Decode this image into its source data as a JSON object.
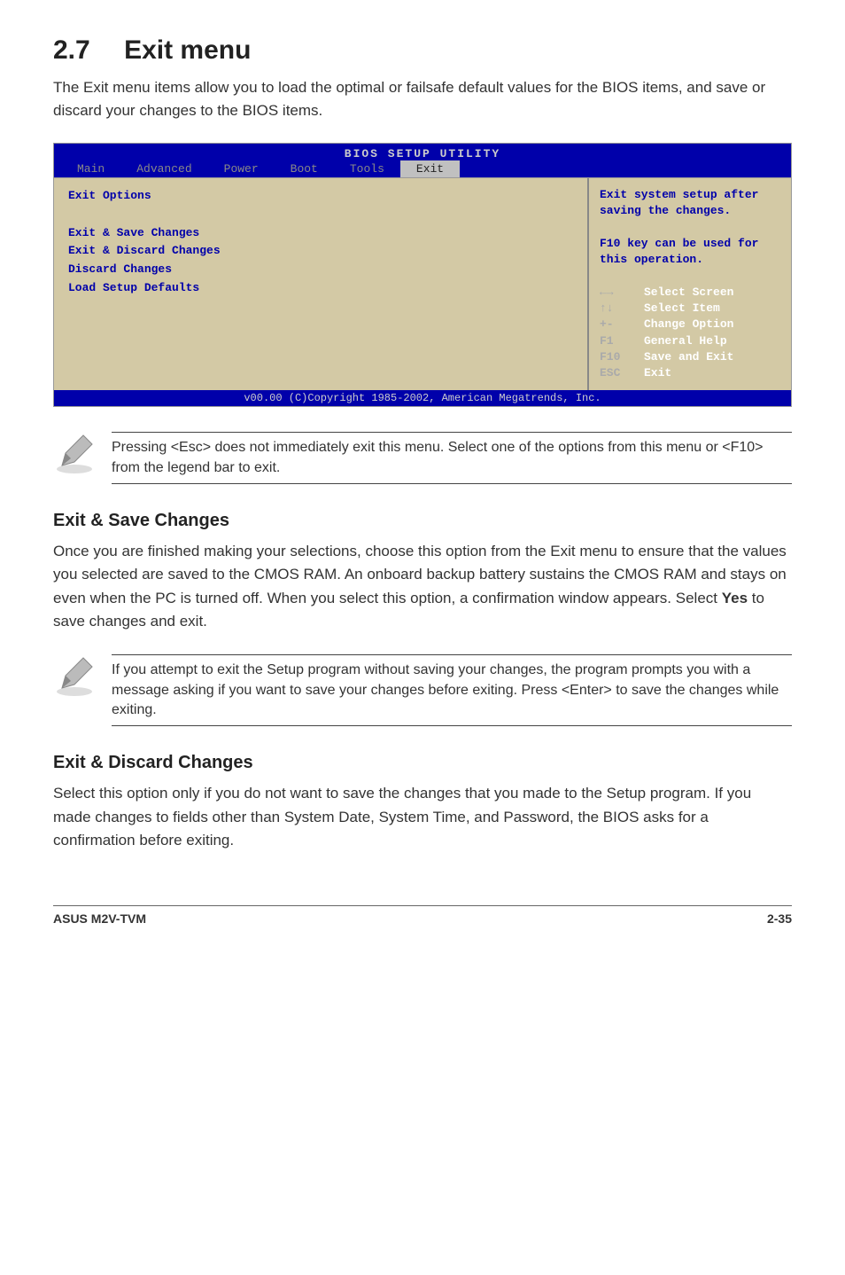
{
  "heading_number": "2.7",
  "heading_title": "Exit menu",
  "intro": "The Exit menu items allow you to load the optimal or failsafe default values for the BIOS items, and save or discard your changes to the BIOS items.",
  "bios": {
    "title": "BIOS SETUP UTILITY",
    "tabs": [
      "Main",
      "Advanced",
      "Power",
      "Boot",
      "Tools",
      "Exit"
    ],
    "left_header": "Exit Options",
    "left_items": [
      "Exit & Save Changes",
      "Exit & Discard Changes",
      "Discard Changes",
      "",
      "Load Setup Defaults"
    ],
    "right_help_1": "Exit system setup after saving the changes.",
    "right_help_2": "F10 key can be used for this operation.",
    "legend": [
      {
        "key": "←→",
        "desc": "Select Screen"
      },
      {
        "key": "↑↓",
        "desc": "Select Item"
      },
      {
        "key": "+-",
        "desc": "Change Option"
      },
      {
        "key": "F1",
        "desc": "General Help"
      },
      {
        "key": "F10",
        "desc": "Save and Exit"
      },
      {
        "key": "ESC",
        "desc": "Exit"
      }
    ],
    "footer": "v00.00 (C)Copyright 1985-2002, American Megatrends, Inc."
  },
  "note1": "Pressing <Esc> does not immediately exit this menu. Select one of the options from this menu or <F10> from the legend bar to exit.",
  "section1_title": "Exit & Save Changes",
  "section1_body_a": "Once you are finished making your selections, choose this option from the Exit menu to ensure that the values you selected are saved to the CMOS RAM. An onboard backup battery sustains the CMOS RAM and stays on even when the PC is turned off. When you select this option, a confirmation window appears. Select ",
  "section1_bold": "Yes",
  "section1_body_b": " to save changes and exit.",
  "note2": " If you attempt to exit the Setup program without saving your changes, the program prompts you with a message asking if you want to save your changes before exiting. Press <Enter>  to save the  changes while exiting.",
  "section2_title": "Exit & Discard Changes",
  "section2_body": "Select this option only if you do not want to save the changes that you made to the Setup program. If you made changes to fields other than System Date, System Time, and Password, the BIOS asks for a confirmation before exiting.",
  "footer_left": "ASUS M2V-TVM",
  "footer_right": "2-35"
}
